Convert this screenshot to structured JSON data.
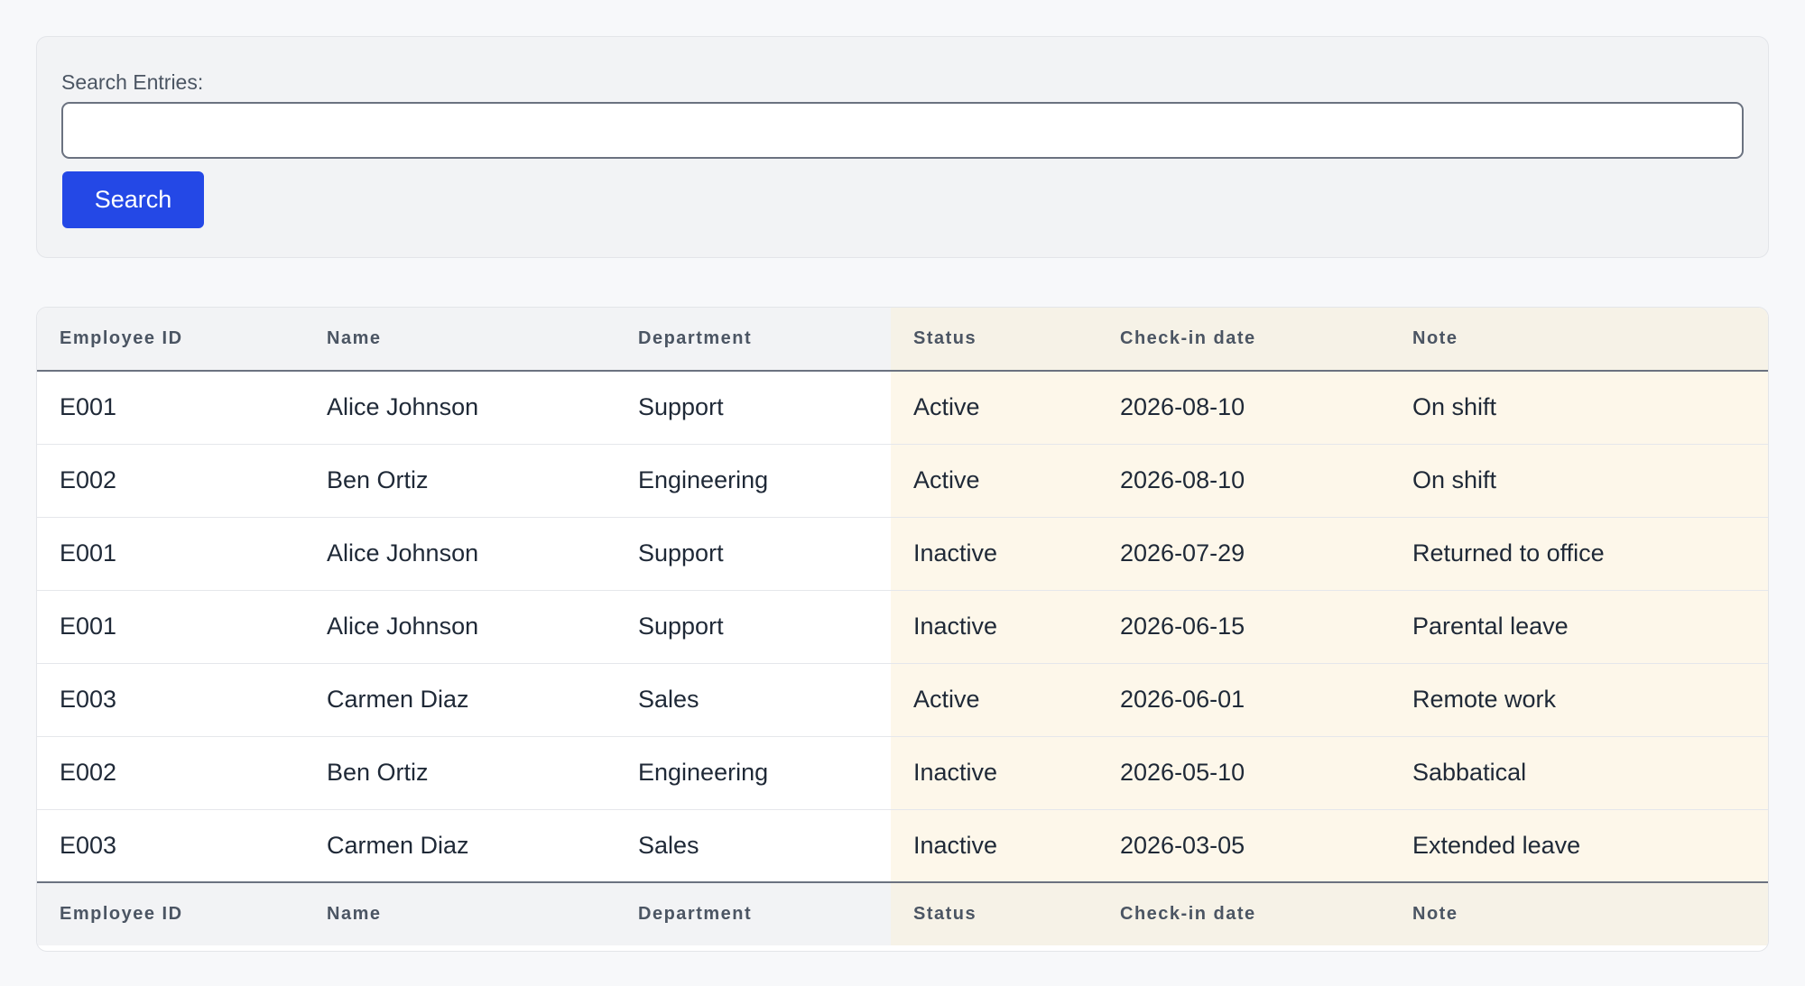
{
  "search": {
    "label": "Search Entries:",
    "value": "",
    "placeholder": "",
    "button_label": "Search",
    "button_color": "#2448e6"
  },
  "table": {
    "columns": [
      "Employee ID",
      "Name",
      "Department",
      "Status",
      "Check-in date",
      "Note"
    ],
    "highlight_color": "#fdf7ea",
    "rows": [
      [
        "E001",
        "Alice Johnson",
        "Support",
        "Active",
        "2026-08-10",
        "On shift"
      ],
      [
        "E002",
        "Ben Ortiz",
        "Engineering",
        "Active",
        "2026-08-10",
        "On shift"
      ],
      [
        "E001",
        "Alice Johnson",
        "Support",
        "Inactive",
        "2026-07-29",
        "Returned to office"
      ],
      [
        "E001",
        "Alice Johnson",
        "Support",
        "Inactive",
        "2026-06-15",
        "Parental leave"
      ],
      [
        "E003",
        "Carmen Diaz",
        "Sales",
        "Active",
        "2026-06-01",
        "Remote work"
      ],
      [
        "E002",
        "Ben Ortiz",
        "Engineering",
        "Inactive",
        "2026-05-10",
        "Sabbatical"
      ],
      [
        "E003",
        "Carmen Diaz",
        "Sales",
        "Inactive",
        "2026-03-05",
        "Extended leave"
      ]
    ]
  }
}
